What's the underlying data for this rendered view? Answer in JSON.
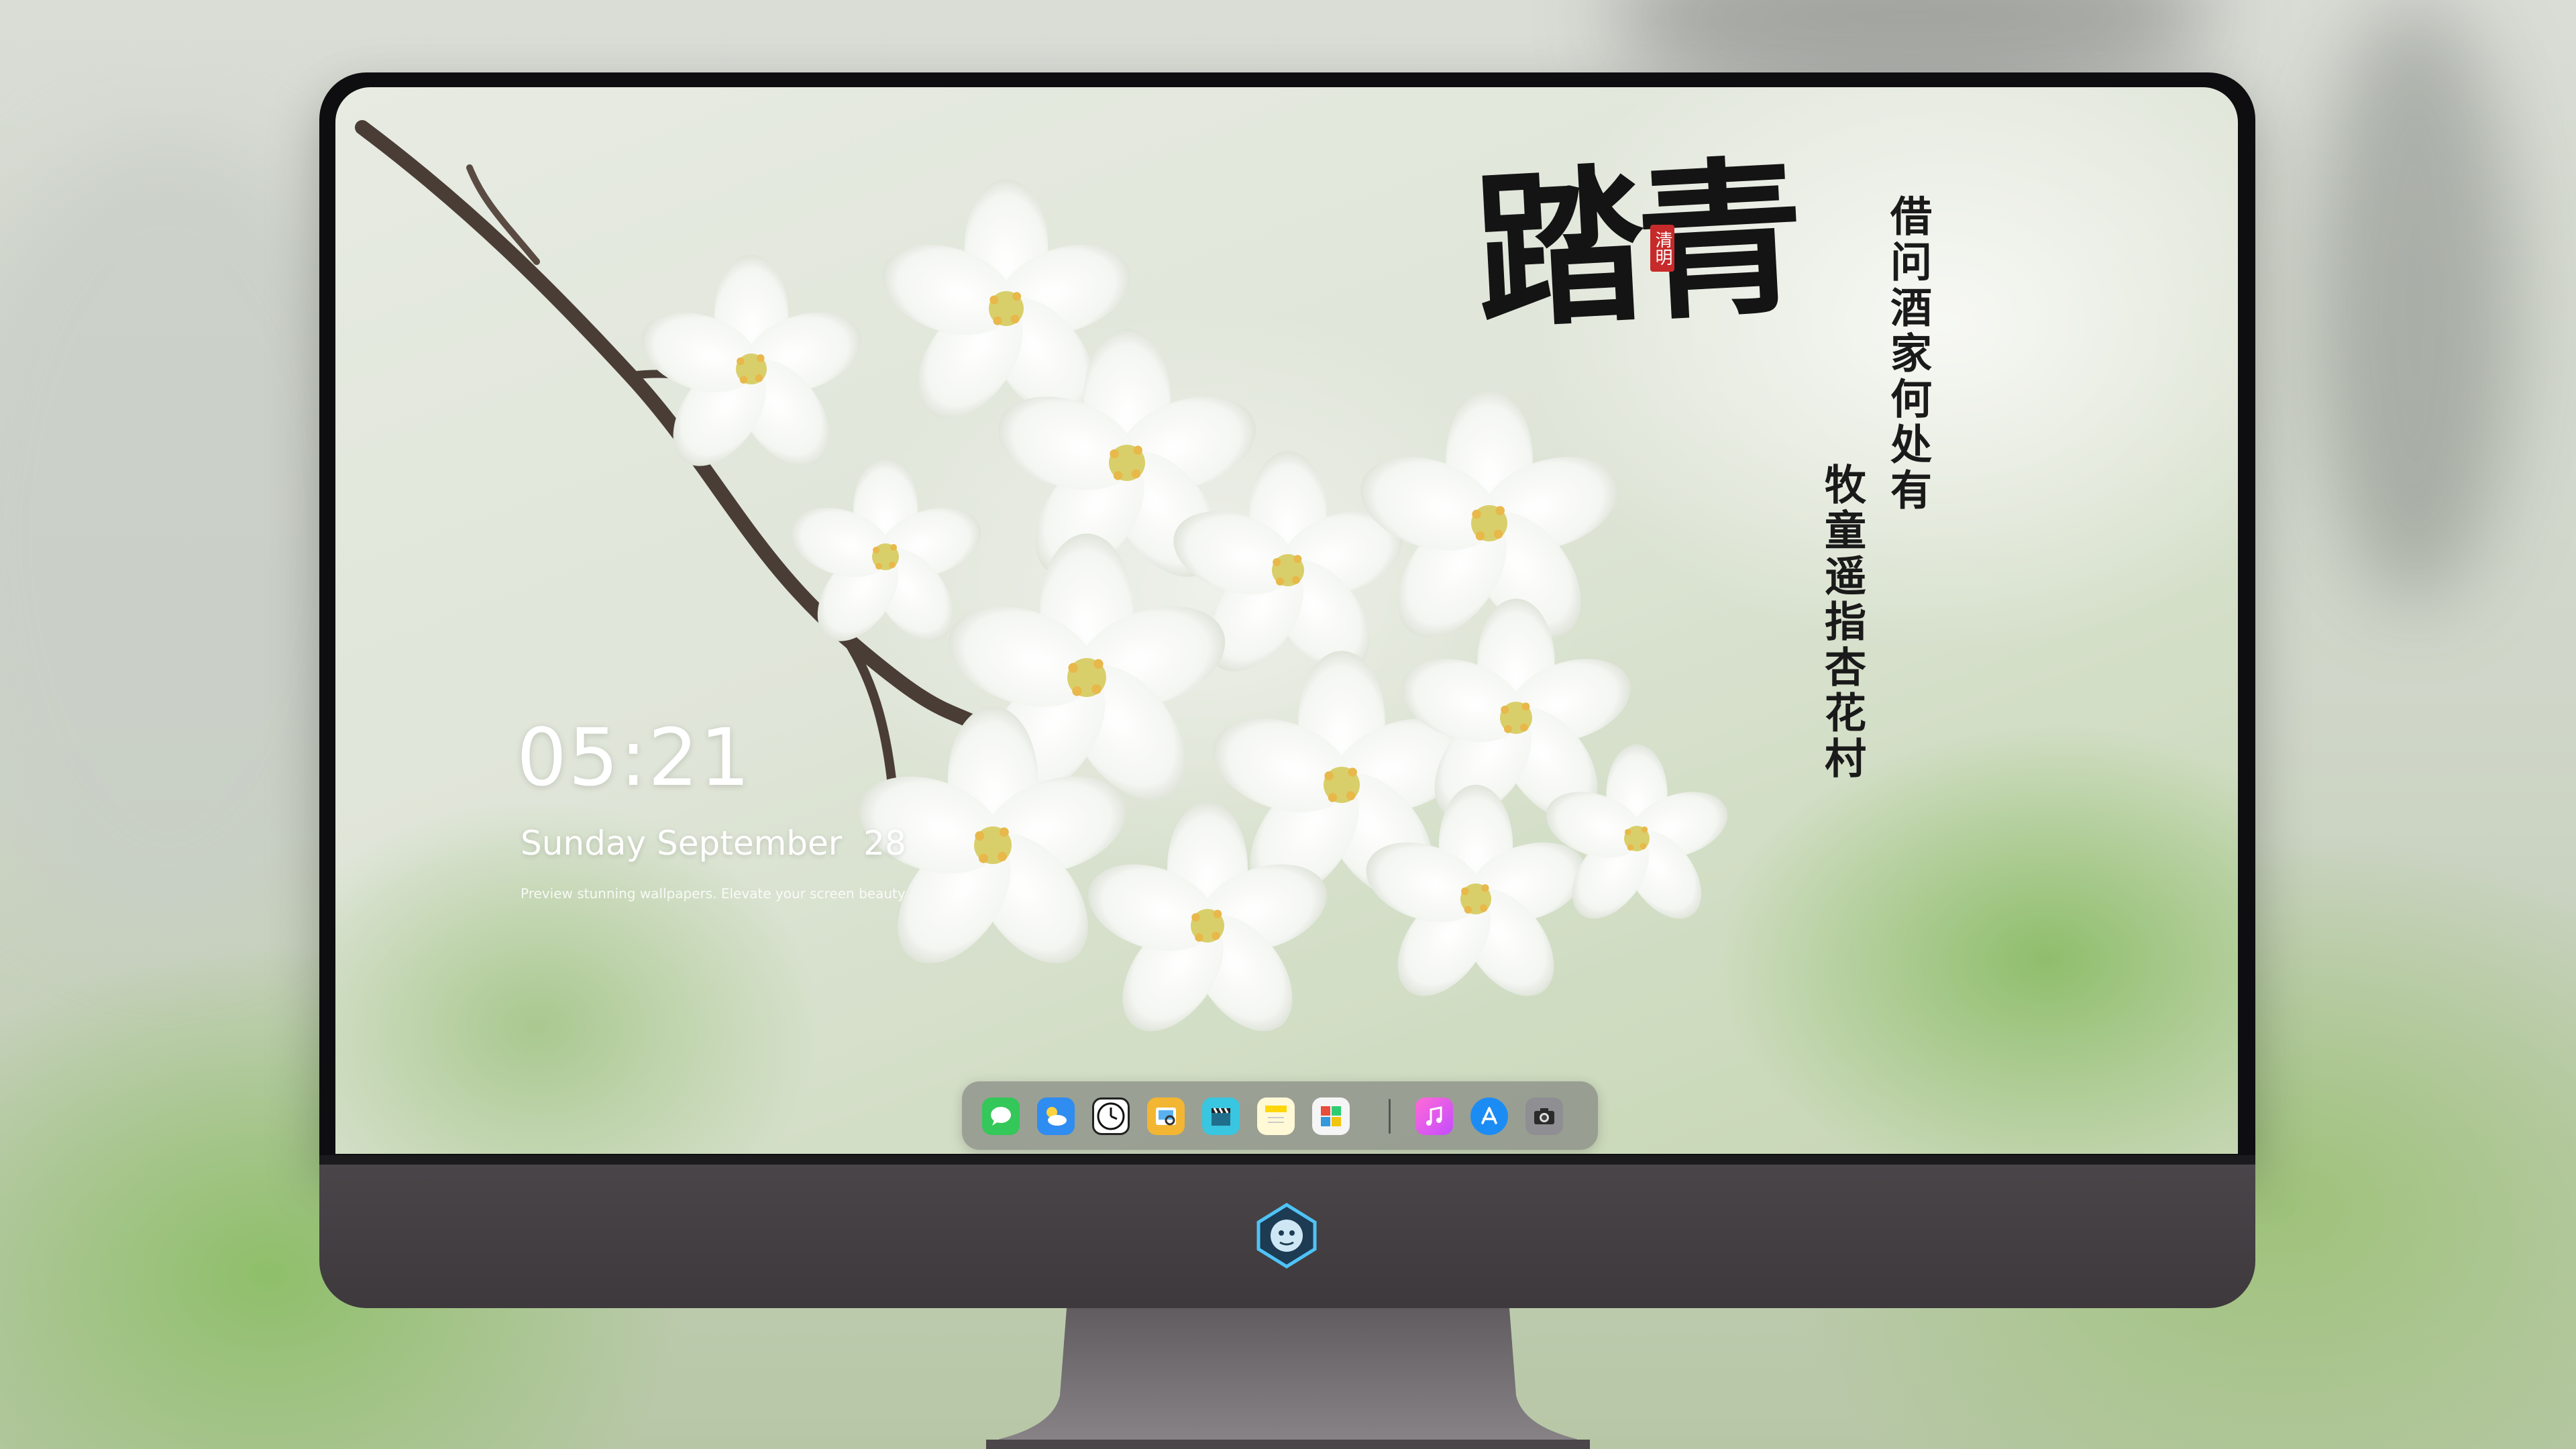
{
  "lockscreen": {
    "time": "05:21",
    "date": "Sunday September  28",
    "caption": "Preview stunning wallpapers. Elevate your screen beauty"
  },
  "wallpaper": {
    "title": "踏青",
    "seal": "清明",
    "poem_line_1": "借问酒家何处有",
    "poem_line_2": "牧童遥指杏花村"
  },
  "dock": {
    "apps": [
      {
        "name": "messages-icon",
        "color": "#34c759"
      },
      {
        "name": "weather-icon",
        "color": "#2f8cf0"
      },
      {
        "name": "clock-icon",
        "color": "#ffffff"
      },
      {
        "name": "preview-icon",
        "color": "#f2b632"
      },
      {
        "name": "clapper-icon",
        "color": "#39c6e0"
      },
      {
        "name": "notes-icon",
        "color": "#ffd60a"
      },
      {
        "name": "photo-booth-icon",
        "color": "#e74c3c"
      },
      {
        "name": "music-icon",
        "color": "#ff4fb8"
      },
      {
        "name": "app-store-icon",
        "color": "#1c8cf5"
      },
      {
        "name": "camera-icon",
        "color": "#8e8e93"
      }
    ]
  },
  "colors": {
    "bezel": "#0e0e10",
    "chin": "#4a4548",
    "seal": "#c72a2a"
  }
}
